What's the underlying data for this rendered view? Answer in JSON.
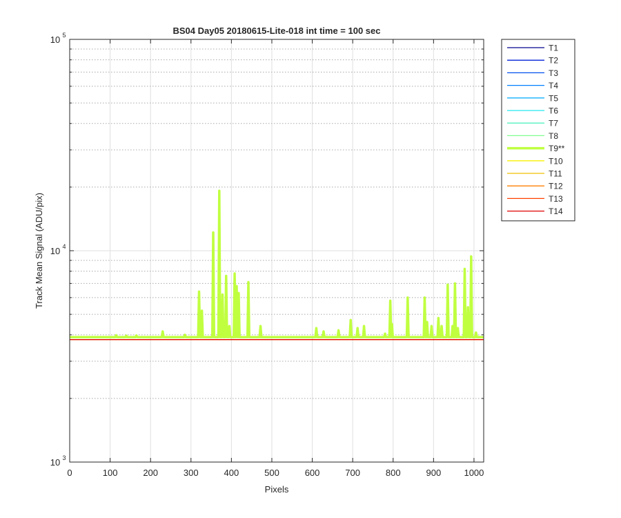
{
  "chart_data": {
    "type": "line",
    "title": "BS04 Day05 20180615-Lite-018 int time = 100 sec",
    "xlabel": "Pixels",
    "ylabel": "Track Mean Signal (ADU/pix)",
    "xlim": [
      0,
      1024
    ],
    "ylim": [
      1000,
      100000
    ],
    "yscale": "log",
    "grid": true,
    "legend_position": "outside-top-right",
    "x_ticks": [
      {
        "value": 0,
        "label": "0"
      },
      {
        "value": 100,
        "label": "100"
      },
      {
        "value": 200,
        "label": "200"
      },
      {
        "value": 300,
        "label": "300"
      },
      {
        "value": 400,
        "label": "400"
      },
      {
        "value": 500,
        "label": "500"
      },
      {
        "value": 600,
        "label": "600"
      },
      {
        "value": 700,
        "label": "700"
      },
      {
        "value": 800,
        "label": "800"
      },
      {
        "value": 900,
        "label": "900"
      },
      {
        "value": 1000,
        "label": "1000"
      }
    ],
    "y_ticks": [
      {
        "value": 1000,
        "base": "10",
        "exp": "3"
      },
      {
        "value": 10000,
        "base": "10",
        "exp": "4"
      },
      {
        "value": 100000,
        "base": "10",
        "exp": "5"
      }
    ],
    "series": [
      {
        "name": "T1",
        "color": "#00008f",
        "baseline": 3800,
        "width": 1.3
      },
      {
        "name": "T2",
        "color": "#0020d8",
        "baseline": 3800,
        "width": 1.3
      },
      {
        "name": "T3",
        "color": "#0050f0",
        "baseline": 3800,
        "width": 1.3
      },
      {
        "name": "T4",
        "color": "#0080ff",
        "baseline": 3800,
        "width": 1.3
      },
      {
        "name": "T5",
        "color": "#10b0ff",
        "baseline": 3800,
        "width": 1.3
      },
      {
        "name": "T6",
        "color": "#20e8f0",
        "baseline": 3800,
        "width": 1.3
      },
      {
        "name": "T7",
        "color": "#50f0c0",
        "baseline": 3800,
        "width": 1.3
      },
      {
        "name": "T8",
        "color": "#80ff90",
        "baseline": 3800,
        "width": 1.3
      },
      {
        "name": "T9**",
        "color": "#c0ff40",
        "width": 3.5,
        "baseline": 3900,
        "peaks": [
          {
            "x": 115,
            "y": 3980
          },
          {
            "x": 140,
            "y": 3960
          },
          {
            "x": 165,
            "y": 3970
          },
          {
            "x": 230,
            "y": 4150
          },
          {
            "x": 285,
            "y": 4000
          },
          {
            "x": 320,
            "y": 6400
          },
          {
            "x": 327,
            "y": 5200
          },
          {
            "x": 355,
            "y": 12200
          },
          {
            "x": 370,
            "y": 19200
          },
          {
            "x": 378,
            "y": 6200
          },
          {
            "x": 387,
            "y": 7600
          },
          {
            "x": 395,
            "y": 4400
          },
          {
            "x": 408,
            "y": 7800
          },
          {
            "x": 413,
            "y": 6800
          },
          {
            "x": 418,
            "y": 6300
          },
          {
            "x": 442,
            "y": 7100
          },
          {
            "x": 472,
            "y": 4400
          },
          {
            "x": 610,
            "y": 4300
          },
          {
            "x": 628,
            "y": 4150
          },
          {
            "x": 665,
            "y": 4200
          },
          {
            "x": 695,
            "y": 4700
          },
          {
            "x": 712,
            "y": 4300
          },
          {
            "x": 728,
            "y": 4400
          },
          {
            "x": 780,
            "y": 4050
          },
          {
            "x": 793,
            "y": 5800
          },
          {
            "x": 797,
            "y": 4500
          },
          {
            "x": 836,
            "y": 6000
          },
          {
            "x": 878,
            "y": 6000
          },
          {
            "x": 884,
            "y": 4600
          },
          {
            "x": 895,
            "y": 4400
          },
          {
            "x": 912,
            "y": 4800
          },
          {
            "x": 920,
            "y": 4400
          },
          {
            "x": 935,
            "y": 6900
          },
          {
            "x": 947,
            "y": 4400
          },
          {
            "x": 953,
            "y": 7000
          },
          {
            "x": 960,
            "y": 4300
          },
          {
            "x": 977,
            "y": 8200
          },
          {
            "x": 985,
            "y": 5400
          },
          {
            "x": 993,
            "y": 9400
          },
          {
            "x": 1005,
            "y": 4100
          }
        ]
      },
      {
        "name": "T10",
        "color": "#f8f000",
        "baseline": 3800,
        "width": 1.3
      },
      {
        "name": "T11",
        "color": "#f0c000",
        "baseline": 3800,
        "width": 1.3
      },
      {
        "name": "T12",
        "color": "#ff8000",
        "baseline": 3800,
        "width": 1.3
      },
      {
        "name": "T13",
        "color": "#ff4000",
        "baseline": 3800,
        "width": 1.3
      },
      {
        "name": "T14",
        "color": "#e00000",
        "baseline": 3800,
        "width": 1.3
      }
    ]
  }
}
